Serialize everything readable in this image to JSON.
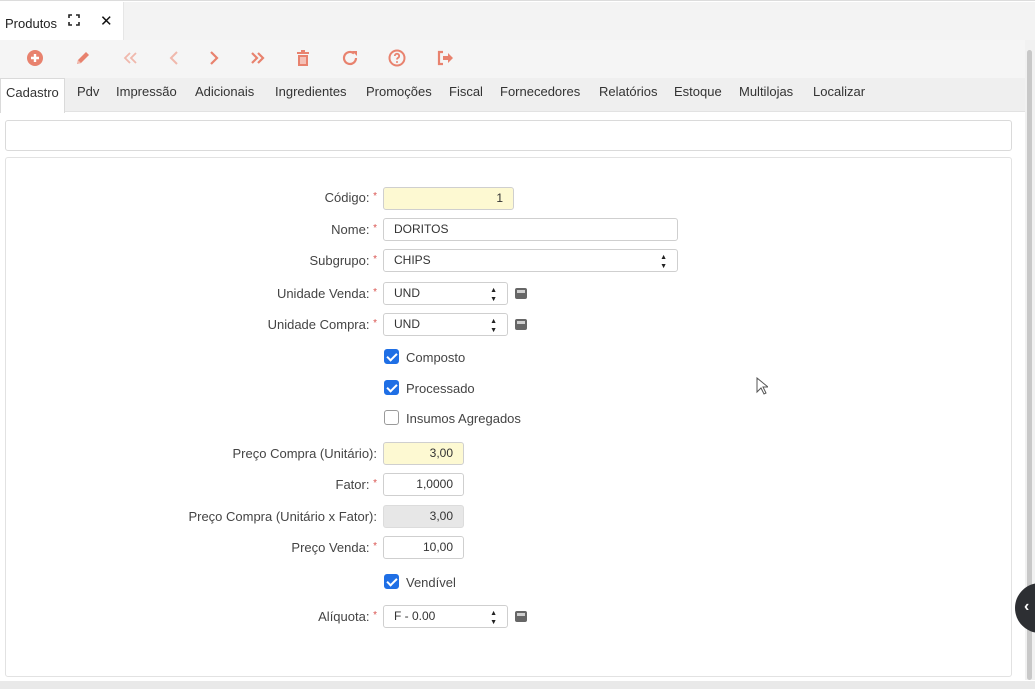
{
  "window": {
    "title": "Produtos",
    "expand_icon": "expand-icon",
    "close_icon": "close-icon"
  },
  "toolbar": {
    "buttons": [
      {
        "name": "add",
        "icon": "plus-circle-icon"
      },
      {
        "name": "edit",
        "icon": "pencil-icon"
      },
      {
        "name": "first",
        "icon": "double-chevron-left-icon"
      },
      {
        "name": "previous",
        "icon": "chevron-left-icon"
      },
      {
        "name": "next",
        "icon": "chevron-right-icon"
      },
      {
        "name": "last",
        "icon": "double-chevron-right-icon"
      },
      {
        "name": "delete",
        "icon": "trash-icon"
      },
      {
        "name": "refresh",
        "icon": "refresh-icon"
      },
      {
        "name": "help",
        "icon": "question-circle-icon"
      },
      {
        "name": "exit",
        "icon": "sign-out-icon"
      }
    ],
    "accent": "#e8826e",
    "disabled": "#f0b8ac"
  },
  "tabs": [
    "Cadastro",
    "Pdv",
    "Impressão",
    "Adicionais",
    "Ingredientes",
    "Promoções",
    "Fiscal",
    "Fornecedores",
    "Relatórios",
    "Estoque",
    "Multilojas",
    "Localizar"
  ],
  "active_tab": "Cadastro",
  "form": {
    "codigo": {
      "label": "Código:",
      "value": "1"
    },
    "nome": {
      "label": "Nome:",
      "value": "DORITOS"
    },
    "subgrupo": {
      "label": "Subgrupo:",
      "value": "CHIPS"
    },
    "unidade_venda": {
      "label": "Unidade Venda:",
      "value": "UND"
    },
    "unidade_compra": {
      "label": "Unidade Compra:",
      "value": "UND"
    },
    "composto": {
      "label": "Composto",
      "checked": true
    },
    "processado": {
      "label": "Processado",
      "checked": true
    },
    "insumos": {
      "label": "Insumos Agregados",
      "checked": false
    },
    "preco_compra": {
      "label": "Preço Compra (Unitário):",
      "value": "3,00"
    },
    "fator": {
      "label": "Fator:",
      "value": "1,0000"
    },
    "preco_compra_fator": {
      "label": "Preço Compra (Unitário x Fator):",
      "value": "3,00"
    },
    "preco_venda": {
      "label": "Preço Venda:",
      "value": "10,00"
    },
    "vendivel": {
      "label": "Vendível",
      "checked": true
    },
    "aliquota": {
      "label": "Alíquota:",
      "value": "F - 0.00"
    },
    "required_mark": "*"
  },
  "colors": {
    "checkbox": "#1f6fe5",
    "required": "#d9534f",
    "highlight_field": "#fdf9d2"
  }
}
